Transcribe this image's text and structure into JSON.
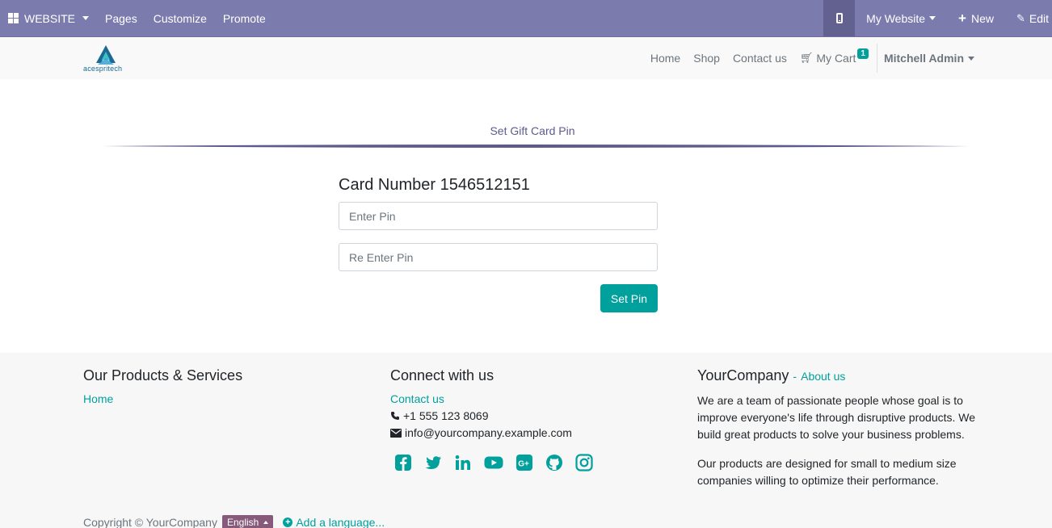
{
  "adminbar": {
    "brand": "WEBSITE",
    "menus": [
      "Pages",
      "Customize",
      "Promote"
    ],
    "site_selector": "My Website",
    "new_label": "New",
    "edit_label": "Edit"
  },
  "navbar": {
    "logo_text": "acespritech",
    "links": [
      "Home",
      "Shop",
      "Contact us"
    ],
    "cart_label": "My Cart",
    "cart_count": "1",
    "user_name": "Mitchell Admin"
  },
  "main": {
    "section_title": "Set Gift Card Pin",
    "card_label": "Card Number 1546512151",
    "pin_placeholder": "Enter Pin",
    "repin_placeholder": "Re Enter Pin",
    "submit_label": "Set Pin"
  },
  "footer": {
    "col1": {
      "title": "Our Products & Services",
      "link": "Home"
    },
    "col2": {
      "title": "Connect with us",
      "contact_link": "Contact us",
      "phone": "+1 555 123 8069",
      "email": "info@yourcompany.example.com",
      "socials": [
        "facebook-icon",
        "twitter-icon",
        "linkedin-icon",
        "youtube-icon",
        "google-plus-icon",
        "github-icon",
        "instagram-icon"
      ]
    },
    "col3": {
      "title": "YourCompany",
      "separator": "-",
      "about_link": "About us",
      "para1": "We are a team of passionate people whose goal is to improve everyone's life through disruptive products. We build great products to solve your business problems.",
      "para2": "Our products are designed for small to medium size companies willing to optimize their performance."
    },
    "copyright": "Copyright © YourCompany",
    "language": "English",
    "add_language": "Add a language..."
  },
  "colors": {
    "adminbar": "#7c7bad",
    "accent": "#00a09d",
    "lang_button": "#875a7b",
    "section_title": "#5c5b8c"
  }
}
